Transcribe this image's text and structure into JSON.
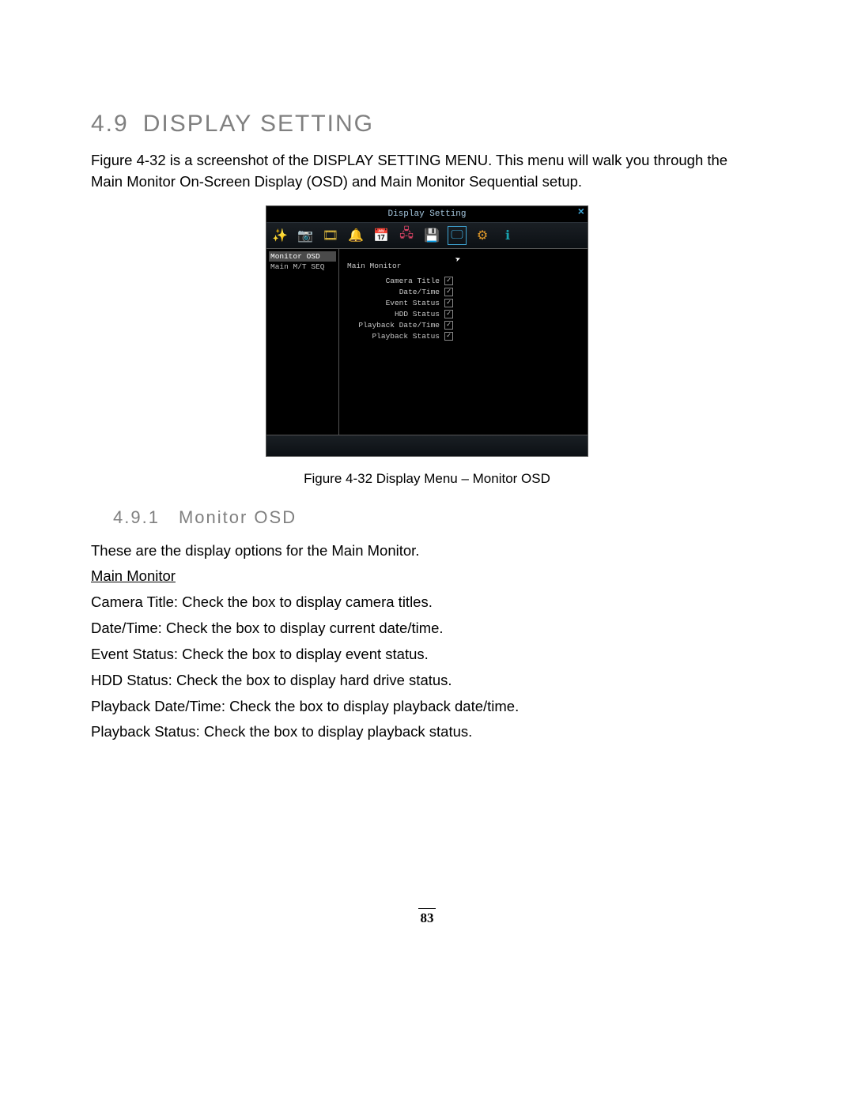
{
  "section": {
    "number": "4.9",
    "title": "DISPLAY SETTING"
  },
  "intro": "Figure 4-32 is a screenshot of the DISPLAY SETTING MENU. This menu will walk you through the Main Monitor On-Screen Display (OSD) and Main Monitor Sequential setup.",
  "figure": {
    "caption": "Figure 4-32 Display Menu – Monitor OSD"
  },
  "shot": {
    "title": "Display Setting",
    "sidebar": [
      "Monitor OSD",
      "Main M/T SEQ"
    ],
    "main_header": "Main Monitor",
    "options": [
      {
        "label": "Camera Title",
        "checked": true
      },
      {
        "label": "Date/Time",
        "checked": true
      },
      {
        "label": "Event Status",
        "checked": true
      },
      {
        "label": "HDD Status",
        "checked": true
      },
      {
        "label": "Playback Date/Time",
        "checked": true
      },
      {
        "label": "Playback Status",
        "checked": true
      }
    ]
  },
  "subsection": {
    "number": "4.9.1",
    "title": "Monitor OSD"
  },
  "subintro": "These are the display options for the Main Monitor.",
  "subheader": "Main Monitor",
  "items": [
    {
      "term": "Camera Title:",
      "desc": " Check the box to display camera titles."
    },
    {
      "term": "Date/Time:",
      "desc": " Check the box to display current date/time."
    },
    {
      "term": "Event Status:",
      "desc": " Check the box to display event status."
    },
    {
      "term": "HDD Status:",
      "desc": " Check the box to display hard drive status."
    },
    {
      "term": "Playback Date/Time:",
      "desc": " Check the box to display playback date/time."
    },
    {
      "term": "Playback Status:",
      "desc": " Check the box to display playback status."
    }
  ],
  "page_number": "83"
}
